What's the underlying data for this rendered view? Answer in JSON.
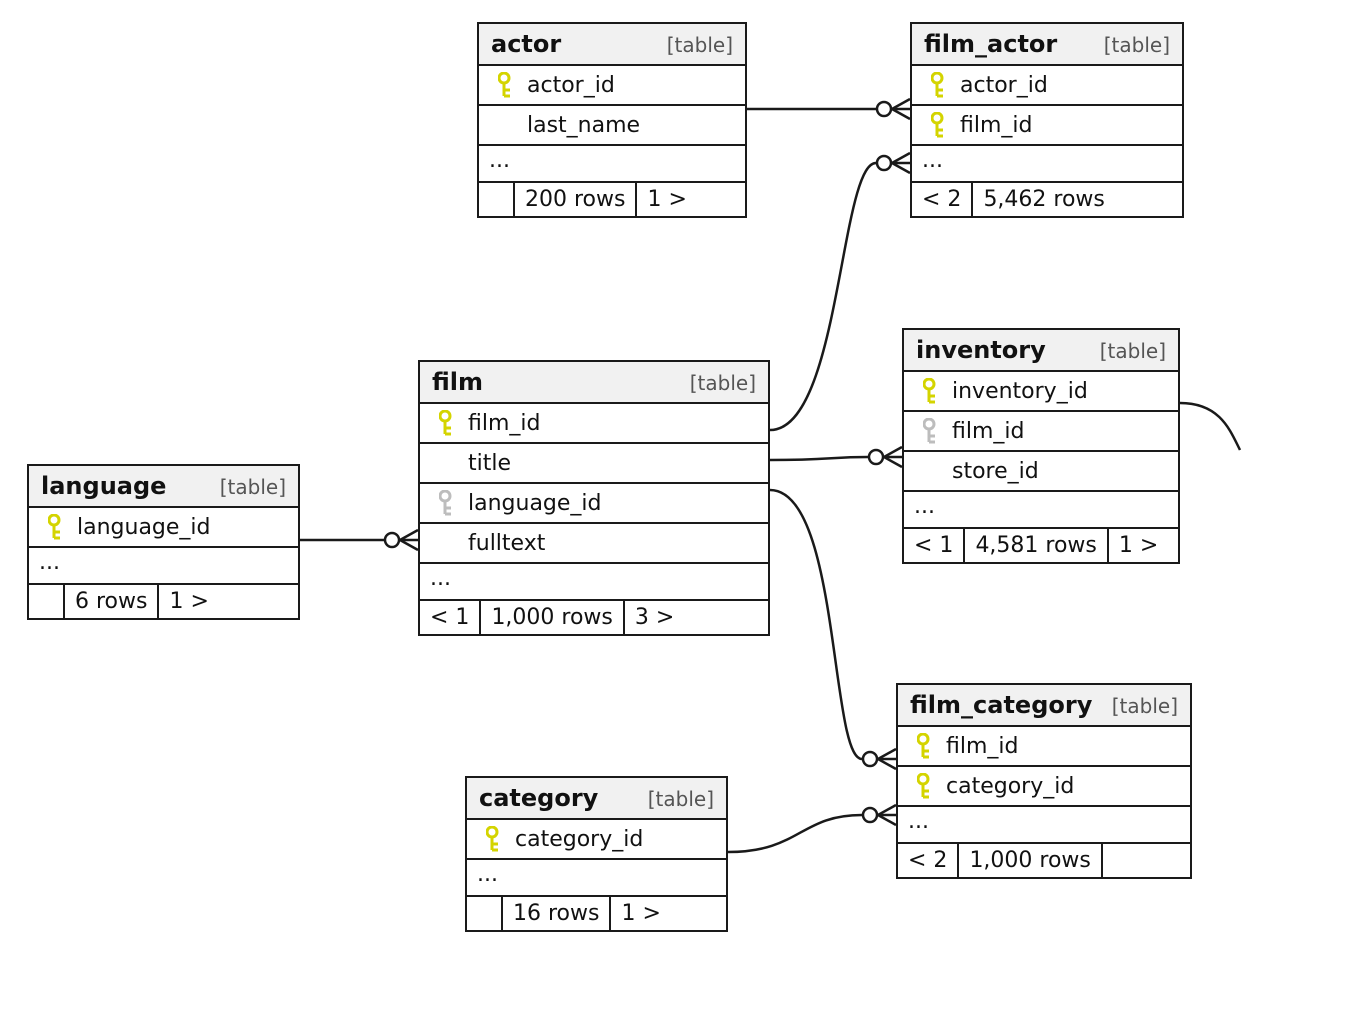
{
  "type_label": "[table]",
  "ellipsis": "...",
  "entities": {
    "actor": {
      "name": "actor",
      "cols": [
        "actor_id",
        "last_name"
      ],
      "footer": {
        "left_blank": true,
        "rows": "200 rows",
        "out": "1 >"
      }
    },
    "film_actor": {
      "name": "film_actor",
      "cols": [
        "actor_id",
        "film_id"
      ],
      "footer": {
        "in": "< 2",
        "rows": "5,462 rows"
      }
    },
    "language": {
      "name": "language",
      "cols": [
        "language_id"
      ],
      "footer": {
        "left_blank": true,
        "rows": "6 rows",
        "out": "1 >"
      }
    },
    "film": {
      "name": "film",
      "cols": [
        "film_id",
        "title",
        "language_id",
        "fulltext"
      ],
      "footer": {
        "in": "< 1",
        "rows": "1,000 rows",
        "out": "3 >"
      }
    },
    "inventory": {
      "name": "inventory",
      "cols": [
        "inventory_id",
        "film_id",
        "store_id"
      ],
      "footer": {
        "in": "< 1",
        "rows": "4,581 rows",
        "out": "1 >"
      }
    },
    "category": {
      "name": "category",
      "cols": [
        "category_id"
      ],
      "footer": {
        "left_blank": true,
        "rows": "16 rows",
        "out": "1 >"
      }
    },
    "film_category": {
      "name": "film_category",
      "cols": [
        "film_id",
        "category_id"
      ],
      "footer": {
        "in": "< 2",
        "rows": "1,000 rows",
        "right_blank": true
      }
    }
  }
}
